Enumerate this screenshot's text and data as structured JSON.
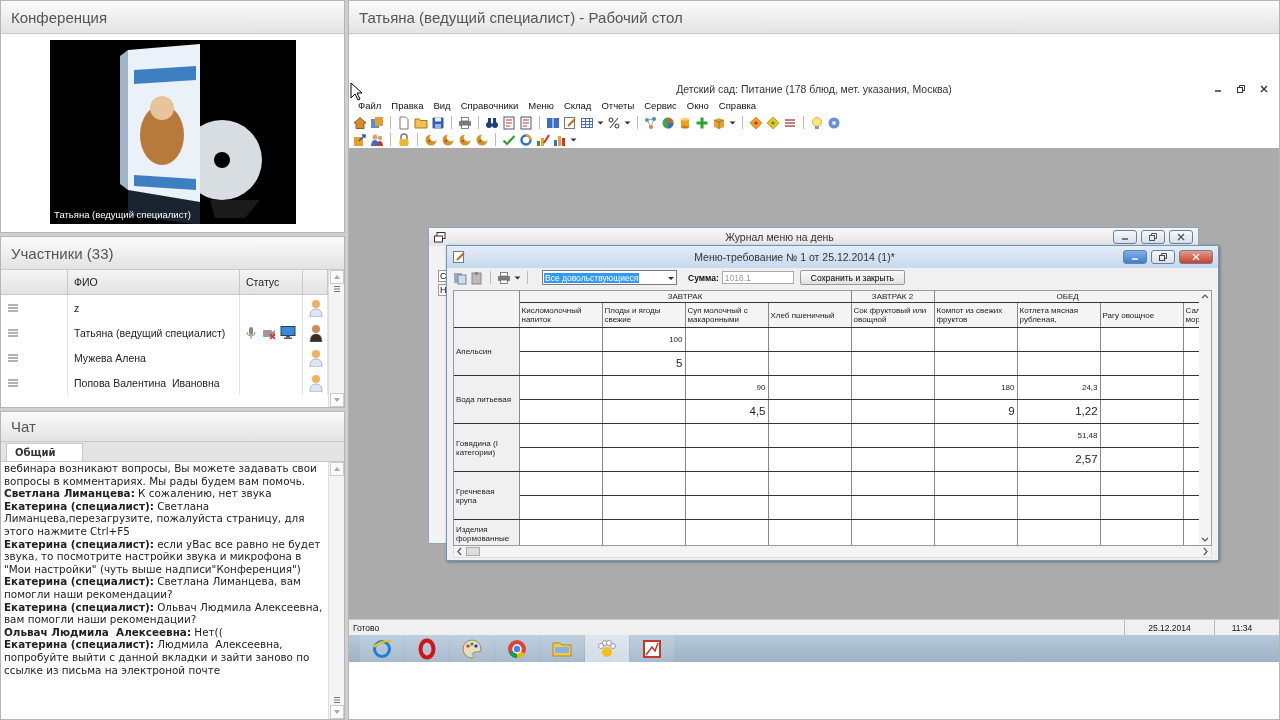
{
  "conference": {
    "title": "Конференция",
    "video_caption": "Татьяна (ведущий специалист)"
  },
  "participants": {
    "title": "Участники (33)",
    "columns": [
      "ФИО",
      "Статус"
    ],
    "rows": [
      {
        "name": "z",
        "presenter": false,
        "media": false
      },
      {
        "name": "Татьяна (ведущий специалист)",
        "presenter": true,
        "media": true
      },
      {
        "name": "Мужева Алена",
        "presenter": false,
        "media": false
      },
      {
        "name": "Попова Валентина  Ивановна",
        "presenter": false,
        "media": false
      }
    ]
  },
  "chat": {
    "title": "Чат",
    "tabs": [
      {
        "label": "Общий",
        "selected": true
      }
    ],
    "messages": [
      "вебинара возникают вопросы, Вы можете задавать свои вопросы в комментариях. Мы рады будем вам помочь.",
      "**Светлана Лиманцева:** К сожалению, нет звука",
      "**Екатерина (специалист):** Светлана Лиманцева,перезагрузите, пожалуйста страницу, для этого нажмите Ctrl+F5",
      "**Екатерина (специалист):** если уВас все равно не будет звука, то посмотрите настройки звука и микрофона в \"Мои настройки\" (чуть выше надписи\"Конференция\")",
      "**Екатерина (специалист):** Светлана Лиманцева, вам помогли наши рекомендации?",
      "**Екатерина (специалист):** Ольвач Людмила Алексеевна, вам помогли наши рекомендации?",
      "**Ольвач Людмила  Алексеевна:** Нет((",
      "**Екатерина (специалист):** Людмила  Алексеевна, попробуйте выйти с данной вкладки и зайти заново по ссылке из письма на электроной почте"
    ]
  },
  "desktop": {
    "title": "Татьяна (ведущий специалист) - Рабочий стол",
    "app": {
      "title": "Детский сад: Питание (178 блюд, мет. указания, Москва)",
      "menu": [
        "Файл",
        "Правка",
        "Вид",
        "Справочники",
        "Меню",
        "Склад",
        "Отчеты",
        "Сервис",
        "Окно",
        "Справка"
      ],
      "back_window": {
        "title": "Журнал меню на день",
        "cut_labels": [
          "С",
          "Н"
        ]
      },
      "dialog": {
        "title": "Меню-требование № 1 от 25.12.2014 (1)*",
        "filter": "Все довольствующиеся",
        "sum_label": "Сумма:",
        "sum": "1016.1",
        "save_button": "Сохранить и закрыть",
        "groups": [
          {
            "label": "ЗАВТРАК",
            "columns": [
              "Кисломолочный напиток",
              "Плоды и ягоды свежие",
              "Суп молочный с макаронными",
              "Хлеб пшеничный"
            ]
          },
          {
            "label": "ЗАВТРАК 2",
            "columns": [
              "Сок фруктовый или овощной"
            ]
          },
          {
            "label": "ОБЕД",
            "columns": [
              "Компот из свежих фруктов",
              "Котлета мясная рубленая,",
              "Рагу овощное",
              "Сал мор"
            ]
          }
        ],
        "rows": [
          {
            "product": "Апельсин",
            "subrows": [
              [
                null,
                "100",
                null,
                null,
                null,
                null,
                null,
                null,
                null
              ],
              [
                null,
                "5",
                null,
                null,
                null,
                null,
                null,
                null,
                null
              ]
            ]
          },
          {
            "product": "Вода питьевая",
            "subrows": [
              [
                null,
                null,
                "90",
                null,
                null,
                "180",
                "24,3",
                null,
                null
              ],
              [
                null,
                null,
                "4,5",
                null,
                null,
                "9",
                "1,22",
                null,
                null
              ]
            ]
          },
          {
            "product": "Говядина (I категории)",
            "subrows": [
              [
                null,
                null,
                null,
                null,
                null,
                null,
                "51,48",
                null,
                null
              ],
              [
                null,
                null,
                null,
                null,
                null,
                null,
                "2,57",
                null,
                null
              ]
            ]
          },
          {
            "product": "Гречневая крупа",
            "subrows": [
              [
                null,
                null,
                null,
                null,
                null,
                null,
                null,
                null,
                null
              ],
              [
                null,
                null,
                null,
                null,
                null,
                null,
                null,
                null,
                null
              ]
            ]
          },
          {
            "product": "Изделия формованные",
            "subrows": [
              [
                null,
                null,
                null,
                null,
                null,
                null,
                null,
                null,
                null
              ]
            ]
          }
        ]
      },
      "status_bar": {
        "message": "Готово",
        "date": "25.12.2014",
        "time": "11:34"
      }
    },
    "taskbar": [
      {
        "kind": "globe",
        "selected": false
      },
      {
        "kind": "ring",
        "selected": false
      },
      {
        "kind": "palette",
        "selected": false
      },
      {
        "kind": "wheel",
        "selected": false
      },
      {
        "kind": "folder",
        "selected": false
      },
      {
        "kind": "paw",
        "selected": true
      },
      {
        "kind": "chart",
        "selected": false
      }
    ]
  }
}
